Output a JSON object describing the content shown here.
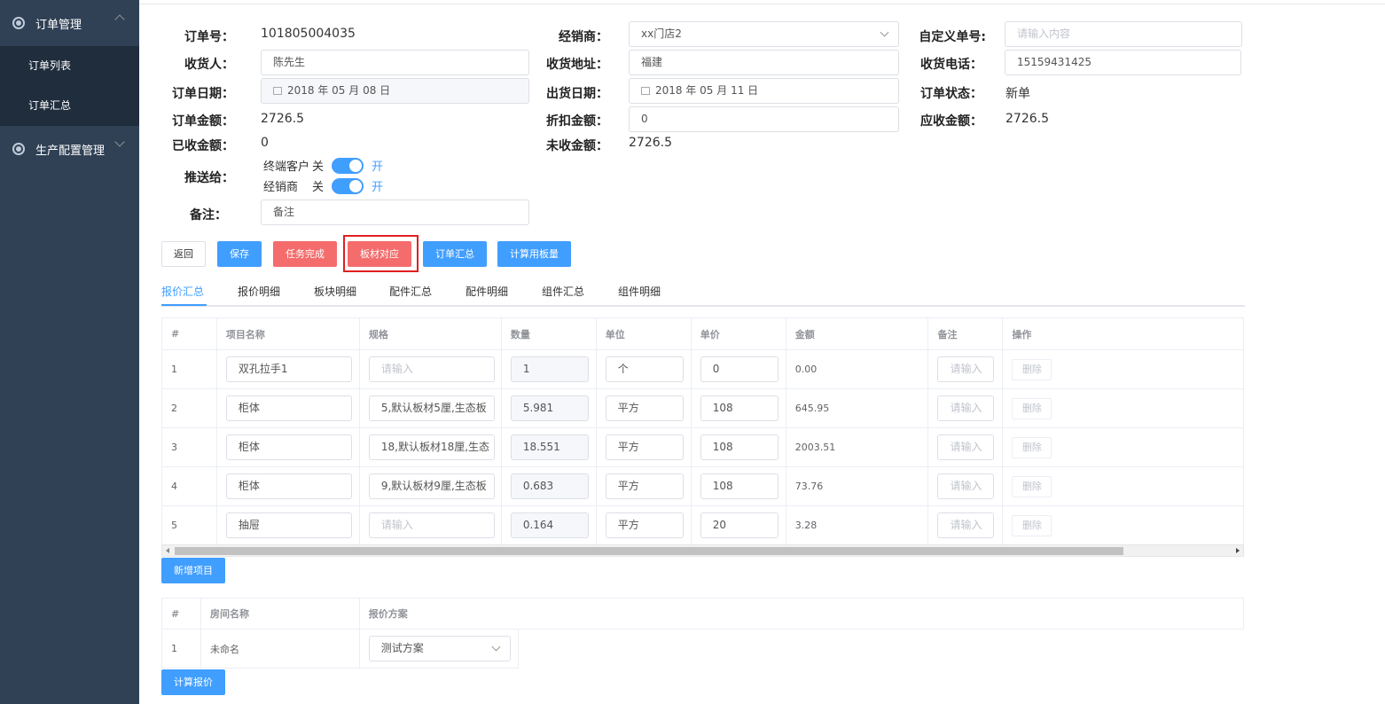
{
  "sidebar": {
    "groups": [
      {
        "label": "订单管理",
        "items": [
          "订单列表",
          "订单汇总"
        ]
      },
      {
        "label": "生产配置管理"
      }
    ]
  },
  "form": {
    "order_no": {
      "label": "订单号：",
      "value": "101805004035"
    },
    "dealer": {
      "label": "经销商：",
      "value": "xx门店2"
    },
    "custom_no": {
      "label": "自定义单号:",
      "placeholder": "请输入内容"
    },
    "receiver": {
      "label": "收货人：",
      "value": "陈先生"
    },
    "address": {
      "label": "收货地址：",
      "value": "福建"
    },
    "phone": {
      "label": "收货电话：",
      "value": "15159431425"
    },
    "order_date": {
      "label": "订单日期：",
      "value": "2018 年 05 月 08 日"
    },
    "ship_date": {
      "label": "出货日期：",
      "value": "2018 年 05 月 11 日"
    },
    "status": {
      "label": "订单状态：",
      "value": "新单"
    },
    "amount": {
      "label": "订单金额：",
      "value": "2726.5"
    },
    "discount": {
      "label": "折扣金额：",
      "value": "0"
    },
    "receivable": {
      "label": "应收金额：",
      "value": "2726.5"
    },
    "received": {
      "label": "已收金额：",
      "value": "0"
    },
    "unreceived": {
      "label": "未收金额：",
      "value": "2726.5"
    },
    "push": {
      "label": "推送给：",
      "off": "关",
      "on": "开",
      "targets": [
        {
          "name": "终端客户",
          "enabled": true
        },
        {
          "name": "经销商",
          "enabled": true
        }
      ]
    },
    "remark": {
      "label": "备注：",
      "value": "备注"
    }
  },
  "toolbar": {
    "back": "返回",
    "save": "保存",
    "complete": "任务完成",
    "board_match": "板材对应",
    "order_summary": "订单汇总",
    "calc_board": "计算用板量"
  },
  "tabs": [
    "报价汇总",
    "报价明细",
    "板块明细",
    "配件汇总",
    "配件明细",
    "组件汇总",
    "组件明细"
  ],
  "quote_table": {
    "headers": [
      "#",
      "项目名称",
      "规格",
      "数量",
      "单位",
      "单价",
      "金额",
      "备注",
      "操作"
    ],
    "placeholder": "请输入",
    "delete_label": "删除",
    "rows": [
      {
        "idx": "1",
        "name": "双孔拉手1",
        "spec": "",
        "qty": "1",
        "unit": "个",
        "price": "0",
        "amount": "0.00"
      },
      {
        "idx": "2",
        "name": "柜体",
        "spec": "5,默认板材5厘,生态板",
        "qty": "5.981",
        "unit": "平方",
        "price": "108",
        "amount": "645.95"
      },
      {
        "idx": "3",
        "name": "柜体",
        "spec": "18,默认板材18厘,生态",
        "qty": "18.551",
        "unit": "平方",
        "price": "108",
        "amount": "2003.51"
      },
      {
        "idx": "4",
        "name": "柜体",
        "spec": "9,默认板材9厘,生态板",
        "qty": "0.683",
        "unit": "平方",
        "price": "108",
        "amount": "73.76"
      },
      {
        "idx": "5",
        "name": "抽屉",
        "spec": "",
        "qty": "0.164",
        "unit": "平方",
        "price": "20",
        "amount": "3.28"
      }
    ]
  },
  "add_item": "新增项目",
  "room_table": {
    "headers": [
      "#",
      "房间名称",
      "报价方案"
    ],
    "rows": [
      {
        "idx": "1",
        "name": "未命名",
        "plan": "测试方案"
      }
    ]
  },
  "calc_quote": "计算报价"
}
